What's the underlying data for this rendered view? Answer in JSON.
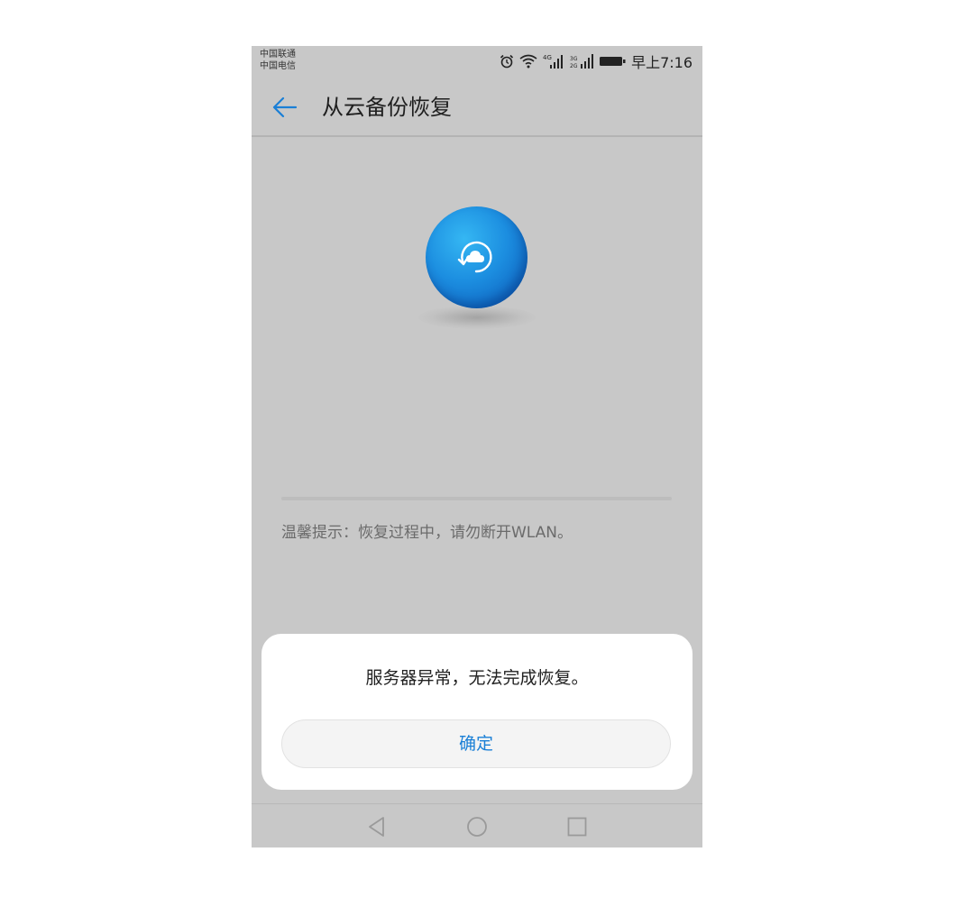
{
  "status_bar": {
    "carrier_1": "中国联通",
    "carrier_2": "中国电信",
    "signal_1_label": "4G",
    "signal_2_label": "3G 2G",
    "time": "早上7:16",
    "icons": [
      "alarm-icon",
      "wifi-icon",
      "signal-4g-icon",
      "signal-3g-2g-icon",
      "battery-icon"
    ]
  },
  "header": {
    "back_icon": "arrow-left-icon",
    "title": "从云备份恢复"
  },
  "main": {
    "orb_icon": "cloud-restore-icon",
    "progress": 0,
    "hint": "温馨提示：恢复过程中，请勿断开WLAN。"
  },
  "dialog": {
    "message": "服务器异常，无法完成恢复。",
    "confirm_label": "确定"
  },
  "nav_bar": {
    "icons": [
      "back-triangle-icon",
      "home-circle-icon",
      "recents-square-icon"
    ]
  },
  "colors": {
    "accent": "#1a7fd6",
    "orb_blue": "#1c8ee0",
    "overlay_bg": "#c8c8c8"
  }
}
